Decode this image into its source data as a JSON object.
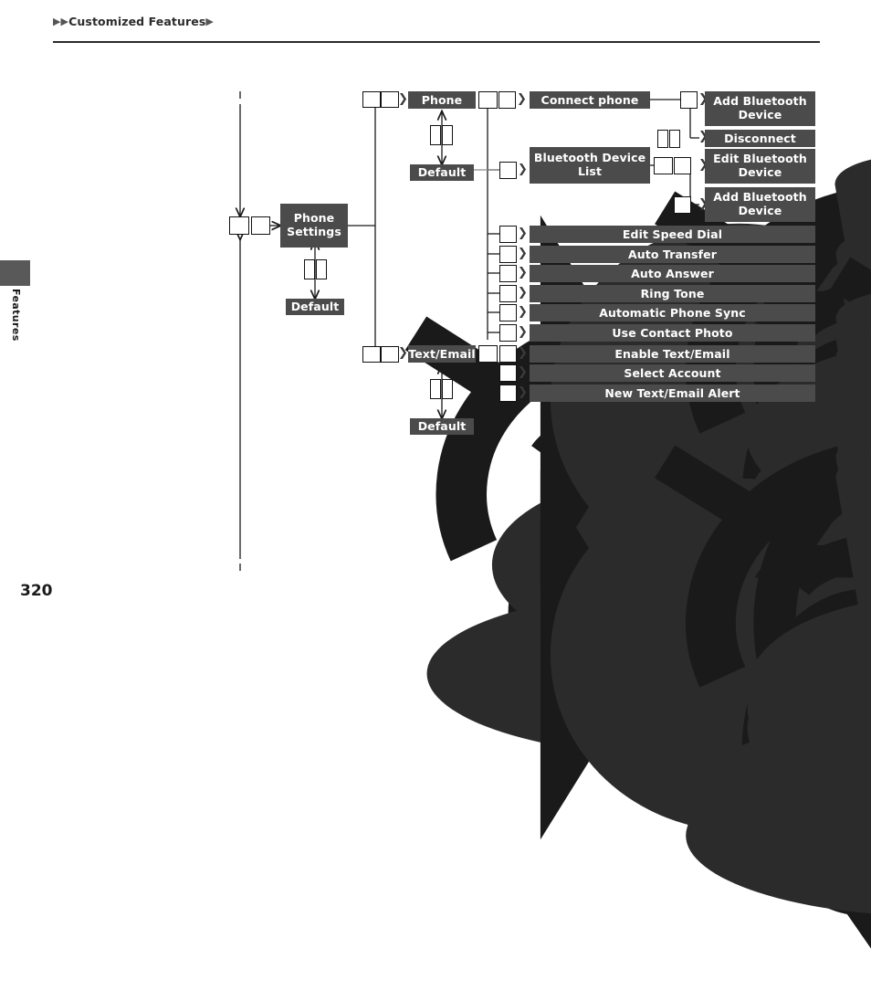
{
  "header": {
    "breadcrumb_text": "Customized Features",
    "leading_marks": "▶▶",
    "trailing_mark": "▶"
  },
  "side_tab": {
    "label": "Features"
  },
  "footer": {
    "page_number": "320"
  },
  "colors": {
    "box_fill": "#4b4b4b",
    "box_text": "#ffffff",
    "line": "#1a1a1a",
    "side_tab_fill": "#595959",
    "rule": "#2b2b2b"
  },
  "diagram": {
    "type": "menu-navigation-tree",
    "root": {
      "label": "Phone Settings",
      "default_label": "Default"
    },
    "icons": {
      "phone": "phone-handset-icon",
      "knob": "select-knob-icon",
      "knob_left": "knob-left-icon",
      "knob_right": "knob-right-icon",
      "knob_up": "knob-up-icon",
      "knob_down": "knob-down-icon"
    },
    "nodes": [
      {
        "id": "phone",
        "label": "Phone",
        "default_label": "Default",
        "entry_icons": [
          "knob-left-icon",
          "knob-right-icon"
        ],
        "adjust_icons": [
          "knob-up-icon",
          "knob-down-icon"
        ],
        "exit_icons": [
          "phone-handset-icon",
          "select-knob-icon"
        ]
      },
      {
        "id": "text-email",
        "label": "Text/Email",
        "default_label": "Default",
        "entry_icons": [
          "knob-left-icon",
          "knob-right-icon"
        ],
        "adjust_icons": [
          "knob-up-icon",
          "knob-down-icon"
        ],
        "exit_icons": [
          "phone-handset-icon",
          "select-knob-icon"
        ]
      }
    ],
    "items": [
      {
        "id": "connect-phone",
        "label": "Connect phone",
        "icon": "select-knob-icon",
        "children": [
          {
            "id": "add-bluetooth-device-1",
            "label": "Add Bluetooth Device",
            "icons": [
              "select-knob-icon"
            ]
          },
          {
            "id": "disconnect",
            "label": "Disconnect",
            "icons": [
              "knob-up-icon",
              "knob-down-icon"
            ]
          }
        ]
      },
      {
        "id": "bluetooth-device-list",
        "label": "Bluetooth Device List",
        "icon": "select-knob-icon",
        "children": [
          {
            "id": "edit-bluetooth-device",
            "label": "Edit Bluetooth Device",
            "icons": [
              "phone-handset-icon",
              "select-knob-icon"
            ]
          },
          {
            "id": "add-bluetooth-device-2",
            "label": "Add Bluetooth Device",
            "icons": [
              "select-knob-icon"
            ]
          }
        ]
      },
      {
        "id": "edit-speed-dial",
        "label": "Edit Speed Dial",
        "icon": "select-knob-icon",
        "children": []
      },
      {
        "id": "auto-transfer",
        "label": "Auto Transfer",
        "icon": "select-knob-icon",
        "children": []
      },
      {
        "id": "auto-answer",
        "label": "Auto Answer",
        "icon": "select-knob-icon",
        "children": []
      },
      {
        "id": "ring-tone",
        "label": "Ring Tone",
        "icon": "select-knob-icon",
        "children": []
      },
      {
        "id": "automatic-phone-sync",
        "label": "Automatic Phone Sync",
        "icon": "select-knob-icon",
        "children": []
      },
      {
        "id": "use-contact-photo",
        "label": "Use Contact Photo",
        "icon": "select-knob-icon",
        "children": []
      },
      {
        "id": "enable-text-email",
        "label": "Enable Text/Email",
        "icon": "select-knob-icon",
        "children": []
      },
      {
        "id": "select-account",
        "label": "Select Account",
        "icon": "select-knob-icon",
        "children": []
      },
      {
        "id": "new-text-email-alert",
        "label": "New Text/Email Alert",
        "icon": "select-knob-icon",
        "children": []
      }
    ]
  }
}
